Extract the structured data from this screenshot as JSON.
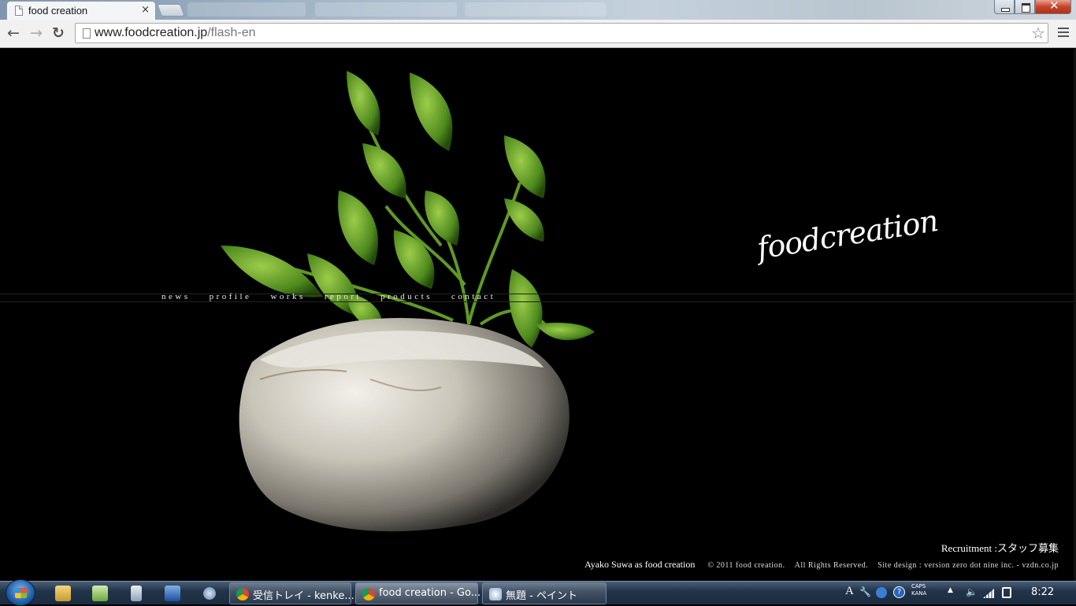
{
  "browser": {
    "tab_title": "food creation",
    "tab_close": "×",
    "url_domain": "www.foodcreation.jp",
    "url_path": "/flash-en",
    "back": "←",
    "forward": "→",
    "reload": "↻",
    "star": "☆",
    "close_window": "✕"
  },
  "site": {
    "logo": "foodcreation",
    "nav": [
      "news",
      "profile",
      "works",
      "report",
      "products",
      "contact"
    ],
    "recruitment": "Recruitment :スタッフ募集",
    "signature": "Ayako Suwa as food creation",
    "copyright": "© 2011 food creation.",
    "rights": "All Rights Reserved.",
    "site_design": "Site design : version zero dot nine inc. - vzdn.co.jp"
  },
  "taskbar": {
    "tasks": [
      {
        "label": "受信トレイ - kenke...",
        "icon": "chrome-icon"
      },
      {
        "label": "food creation - Go...",
        "icon": "chrome-icon"
      },
      {
        "label": "無題 - ペイント",
        "icon": "paint-icon"
      }
    ],
    "caps_line1": "CAPS",
    "caps_line2": "KANA",
    "ime": "A",
    "clock": "8:22"
  }
}
